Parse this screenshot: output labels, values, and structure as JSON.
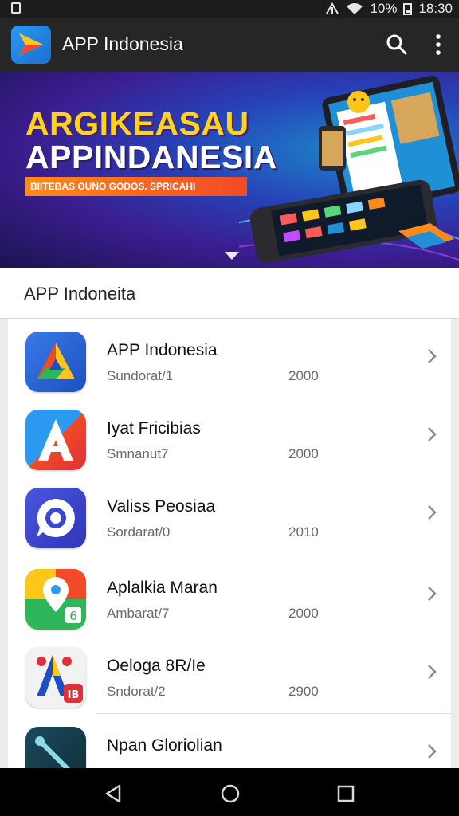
{
  "status_bar": {
    "battery": "10%",
    "time": "18:30"
  },
  "app_bar": {
    "title": "APP Indonesia",
    "icons": [
      "search-icon",
      "more-vert-icon"
    ]
  },
  "banner": {
    "headline_1": "ARGIKEASAU",
    "headline_2": "APPINDANESIA",
    "tagline": "BIITEBAS OUNO GODOS. SPRICAHI"
  },
  "section": {
    "title": "APP Indoneita"
  },
  "apps": [
    {
      "name": "APP Indonesia",
      "category": "Sundorat/1",
      "year": "2000",
      "icon": "app-icon-delta"
    },
    {
      "name": "Iyat Fricibias",
      "category": "Smnanut7",
      "year": "2000",
      "icon": "app-icon-letter-a"
    },
    {
      "name": "Valiss Peosiaa",
      "category": "Sordarat/0",
      "year": "2010",
      "icon": "app-icon-chat"
    },
    {
      "name": "Aplalkia Maran",
      "category": "Ambarat/7",
      "year": "2000",
      "icon": "app-icon-map-pin"
    },
    {
      "name": "Oeloga 8R/Ie",
      "category": "Sndorat/2",
      "year": "2900",
      "icon": "app-icon-map-a"
    },
    {
      "name": "Npan Gloriolian",
      "category": "",
      "year": "",
      "icon": "app-icon-tool"
    }
  ],
  "nav_bar": {
    "icons": [
      "back-icon",
      "home-icon",
      "recents-icon"
    ]
  },
  "colors": {
    "app_bar": "#262626",
    "status_bar": "#1c1c1c",
    "banner_accent": "#ffd21c",
    "nav_bar": "#000000"
  }
}
